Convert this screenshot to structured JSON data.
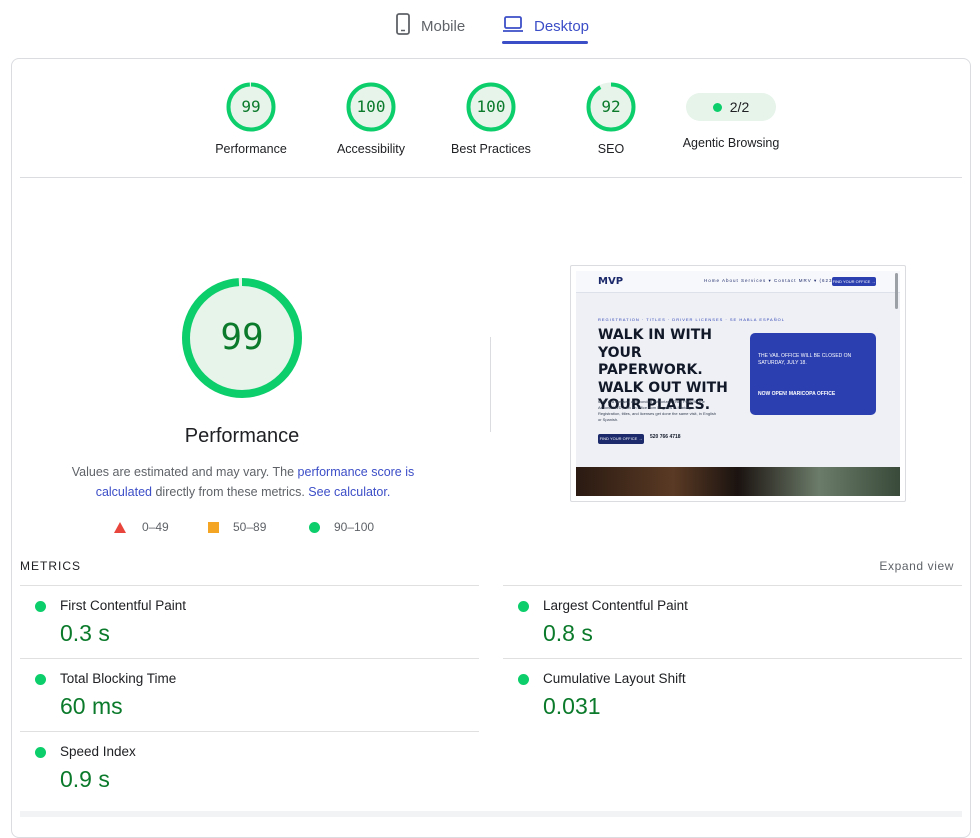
{
  "tabs": [
    {
      "label": "Mobile",
      "icon": "smartphone-icon",
      "active": false
    },
    {
      "label": "Desktop",
      "icon": "laptop-icon",
      "active": true
    }
  ],
  "colors": {
    "accent": "#3c4ec7",
    "pass": "#0cce6b",
    "pass_text": "#0b7a2b",
    "average": "#f4a523",
    "fail": "#e8453c"
  },
  "gauges": [
    {
      "score": "99",
      "label": "Performance",
      "fraction": 0.99
    },
    {
      "score": "100",
      "label": "Accessibility",
      "fraction": 1.0
    },
    {
      "score": "100",
      "label": "Best Practices",
      "fraction": 1.0
    },
    {
      "score": "92",
      "label": "SEO",
      "fraction": 0.92
    }
  ],
  "agentic": {
    "value": "2/2",
    "label": "Agentic Browsing"
  },
  "performance": {
    "score": "99",
    "fraction": 0.99,
    "title": "Performance",
    "desc_1": "Values are estimated and may vary. The ",
    "link_score": "performance score is calculated",
    "desc_2": " directly from these metrics. ",
    "link_calc": "See calculator."
  },
  "legend": {
    "fail": "0–49",
    "average": "50–89",
    "pass": "90–100"
  },
  "screenshot": {
    "logo": "MVP",
    "nav_links": "Home   About   Services ▾   Contact   MRV ▾   (623) 910-4718",
    "nav_button": "FIND YOUR OFFICE →",
    "kicker": "REGISTRATION · TITLES · DRIVER LICENSES · SE HABLA ESPAÑOL",
    "headline": "Walk in with your paperwork. Walk out with your plates.",
    "copy": "MVP is a licensed and bonded authorized Third Party for the Arizona MVD, with an office from Nogales to Maricopa. Registration, titles, and licenses get done the same visit, in English or Spanish.",
    "cta": "FIND YOUR OFFICE →",
    "phone": "520 766 4718",
    "card_text": "THE VAIL OFFICE WILL BE CLOSED ON SATURDAY, JULY 18.",
    "card_sub": "NOW OPEN! MARICOPA OFFICE"
  },
  "metrics": {
    "heading": "METRICS",
    "expand": "Expand view",
    "items": [
      {
        "name": "First Contentful Paint",
        "value": "0.3 s"
      },
      {
        "name": "Largest Contentful Paint",
        "value": "0.8 s"
      },
      {
        "name": "Total Blocking Time",
        "value": "60 ms"
      },
      {
        "name": "Cumulative Layout Shift",
        "value": "0.031"
      },
      {
        "name": "Speed Index",
        "value": "0.9 s"
      }
    ]
  }
}
